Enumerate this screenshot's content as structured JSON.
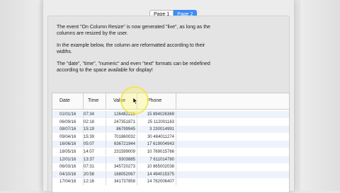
{
  "tabs": [
    {
      "label": "Page 1",
      "active": false
    },
    {
      "label": "Page 2",
      "active": true
    }
  ],
  "description": [
    "The event \"On Column Resize\" is now generated \"live\", as long as the columns are resized by the user.",
    "In the example below, the column are reformatted according to their widths.",
    "The \"date\", \"time\", \"numeric\" and even \"text\" formats can be redefined according to the space available for display!"
  ],
  "table": {
    "columns": [
      "Date",
      "Time",
      "Value",
      "Phone"
    ],
    "rows": [
      [
        "01/01/16",
        "07:34",
        "126482216",
        "15 894026369"
      ],
      [
        "06/09/16",
        "02:18",
        "247351871",
        "25 112001163"
      ],
      [
        "08/07/16",
        "15:19",
        "86799945",
        "3 230014991"
      ],
      [
        "09/04/16",
        "15:39",
        "701860032",
        "30 484011274"
      ],
      [
        "16/06/16",
        "05:07",
        "636721944",
        "17 619004943"
      ],
      [
        "18/05/16",
        "14:07",
        "231599009",
        "10 769015766"
      ],
      [
        "12/01/16",
        "13:37",
        "9303885",
        "7 611014780"
      ],
      [
        "06/03/16",
        "07:31",
        "345720273",
        "10 865002038"
      ],
      [
        "04/10/16",
        "20:58",
        "168052067",
        "14 494015375"
      ],
      [
        "17/04/16",
        "12:16",
        "341737858",
        "14 782006407"
      ]
    ]
  },
  "colors": {
    "accent": "#3b8cf6",
    "row_alt": "#eef3fb",
    "highlight": "#f0e13c"
  },
  "icons": {
    "cursor": "arrow-cursor-icon"
  }
}
